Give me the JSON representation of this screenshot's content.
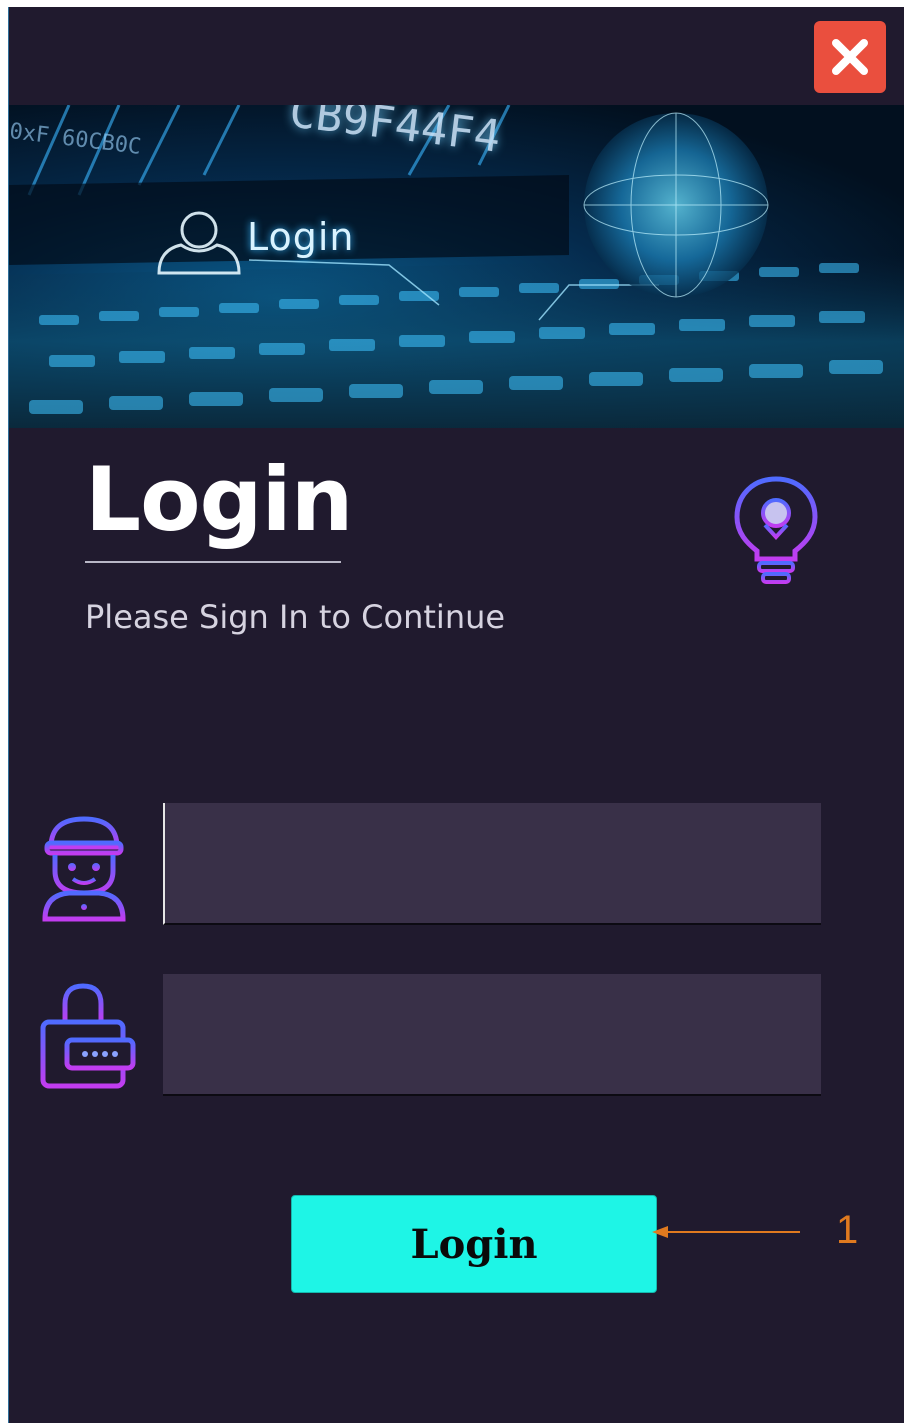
{
  "window": {
    "close_icon": "close-x-icon",
    "background": "#201a2e"
  },
  "banner": {
    "login_text": "Login",
    "hex_text": "CB9F44F4",
    "hex_text_small": "0xF 60CB0C",
    "icons": [
      "user-outline-icon",
      "globe-icon",
      "keyboard-image"
    ]
  },
  "header": {
    "title": "Login",
    "subtitle": "Please Sign In to Continue",
    "icon": "lightbulb-icon"
  },
  "form": {
    "username": {
      "value": "",
      "placeholder": "",
      "icon": "user-avatar-icon"
    },
    "password": {
      "value": "",
      "placeholder": "",
      "icon": "lock-password-icon"
    },
    "submit_label": "Login"
  },
  "annotation": {
    "label": "1",
    "color": "#e07a1f"
  },
  "colors": {
    "accent": "#1ef5e6",
    "close": "#ea4f3e",
    "field_bg": "#393048",
    "icon_gradient_start": "#4f6bff",
    "icon_gradient_end": "#c23cf0"
  }
}
